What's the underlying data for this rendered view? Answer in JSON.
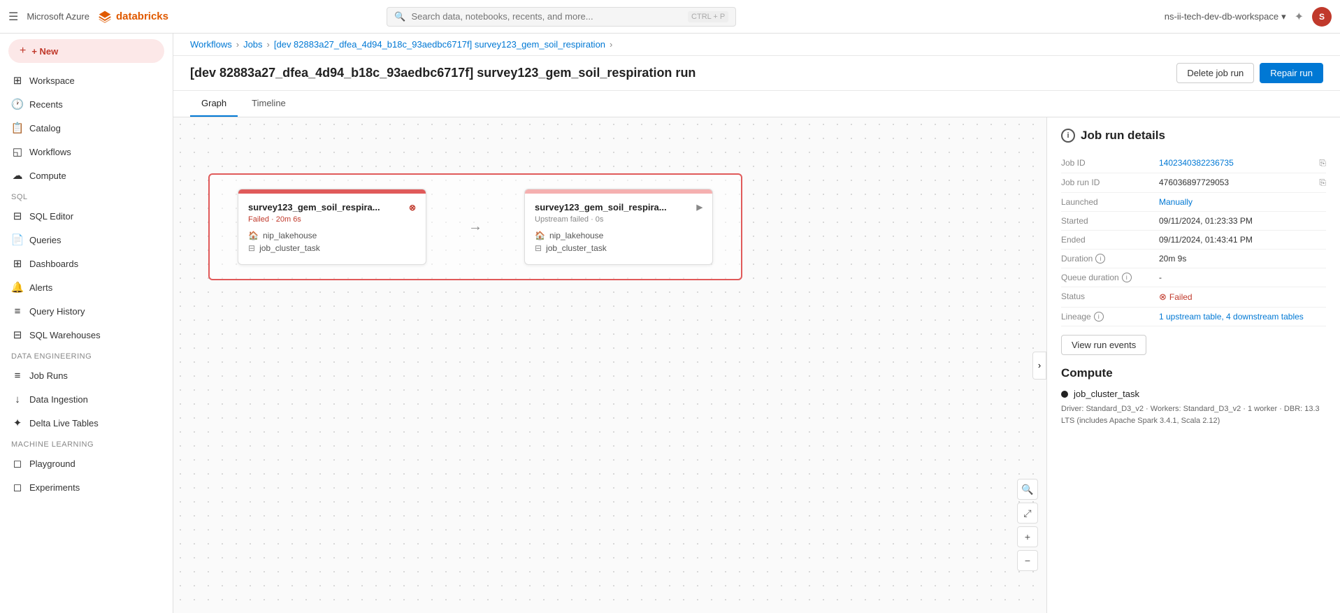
{
  "topbar": {
    "menu_icon": "☰",
    "azure_label": "Microsoft Azure",
    "logo_text": "databricks",
    "search_placeholder": "Search data, notebooks, recents, and more...",
    "search_shortcut": "CTRL + P",
    "workspace_name": "ns-ii-tech-dev-db-workspace",
    "avatar_initials": "S"
  },
  "sidebar": {
    "new_label": "+ New",
    "items": [
      {
        "id": "workspace",
        "label": "Workspace",
        "icon": "⊞"
      },
      {
        "id": "recents",
        "label": "Recents",
        "icon": "🕐"
      },
      {
        "id": "catalog",
        "label": "Catalog",
        "icon": "📋"
      },
      {
        "id": "workflows",
        "label": "Workflows",
        "icon": "◱"
      },
      {
        "id": "compute",
        "label": "Compute",
        "icon": "☁"
      }
    ],
    "sql_section": "SQL",
    "sql_items": [
      {
        "id": "sql-editor",
        "label": "SQL Editor",
        "icon": "⊟"
      },
      {
        "id": "queries",
        "label": "Queries",
        "icon": "📄"
      },
      {
        "id": "dashboards",
        "label": "Dashboards",
        "icon": "⊞"
      },
      {
        "id": "alerts",
        "label": "Alerts",
        "icon": "🔔"
      },
      {
        "id": "query-history",
        "label": "Query History",
        "icon": "≡"
      },
      {
        "id": "sql-warehouses",
        "label": "SQL Warehouses",
        "icon": "⊟"
      }
    ],
    "data_engineering_section": "Data Engineering",
    "data_engineering_items": [
      {
        "id": "job-runs",
        "label": "Job Runs",
        "icon": "≡"
      },
      {
        "id": "data-ingestion",
        "label": "Data Ingestion",
        "icon": "↓"
      },
      {
        "id": "delta-live-tables",
        "label": "Delta Live Tables",
        "icon": "✦"
      }
    ],
    "ml_section": "Machine Learning",
    "ml_items": [
      {
        "id": "playground",
        "label": "Playground",
        "icon": "◻"
      },
      {
        "id": "experiments",
        "label": "Experiments",
        "icon": "◻"
      }
    ]
  },
  "breadcrumb": {
    "items": [
      "Workflows",
      "Jobs",
      "[dev 82883a27_dfea_4d94_b18c_93aedbc6717f] survey123_gem_soil_respiration"
    ],
    "current": ""
  },
  "page_header": {
    "title": "[dev 82883a27_dfea_4d94_b18c_93aedbc6717f] survey123_gem_soil_respiration run",
    "delete_btn": "Delete job run",
    "repair_btn": "Repair run"
  },
  "tabs": [
    {
      "id": "graph",
      "label": "Graph",
      "active": true
    },
    {
      "id": "timeline",
      "label": "Timeline",
      "active": false
    }
  ],
  "task_nodes": [
    {
      "id": "node1",
      "title": "survey123_gem_soil_respira...",
      "fail_icon": "⊗",
      "status": "Failed · 20m 6s",
      "status_type": "failed",
      "resource1": "nip_lakehouse",
      "resource2": "job_cluster_task",
      "has_red_header": true
    },
    {
      "id": "node2",
      "title": "survey123_gem_soil_respira...",
      "arrow_icon": "▶",
      "status": "Upstream failed · 0s",
      "status_type": "upstream",
      "resource1": "nip_lakehouse",
      "resource2": "job_cluster_task",
      "has_red_header": false
    }
  ],
  "details": {
    "section_title": "Job run details",
    "rows": [
      {
        "label": "Job ID",
        "value": "1402340382236735",
        "type": "link"
      },
      {
        "label": "Job run ID",
        "value": "476036897729053",
        "type": "copy"
      },
      {
        "label": "Launched",
        "value": "Manually",
        "type": "link"
      },
      {
        "label": "Started",
        "value": "09/11/2024, 01:23:33 PM",
        "type": "text"
      },
      {
        "label": "Ended",
        "value": "09/11/2024, 01:43:41 PM",
        "type": "text"
      },
      {
        "label": "Duration",
        "value": "20m 9s",
        "type": "text",
        "has_info": true
      },
      {
        "label": "Queue duration",
        "value": "-",
        "type": "text",
        "has_info": true
      },
      {
        "label": "Status",
        "value": "Failed",
        "type": "failed"
      },
      {
        "label": "Lineage",
        "value": "1 upstream table, 4 downstream tables",
        "type": "link",
        "has_info": true
      }
    ],
    "view_run_btn": "View run events",
    "compute_title": "Compute",
    "compute_items": [
      {
        "name": "job_cluster_task",
        "description": "Driver: Standard_D3_v2 · Workers: Standard_D3_v2 · 1 worker · DBR: 13.3 LTS (includes Apache Spark 3.4.1, Scala 2.12)"
      }
    ]
  }
}
